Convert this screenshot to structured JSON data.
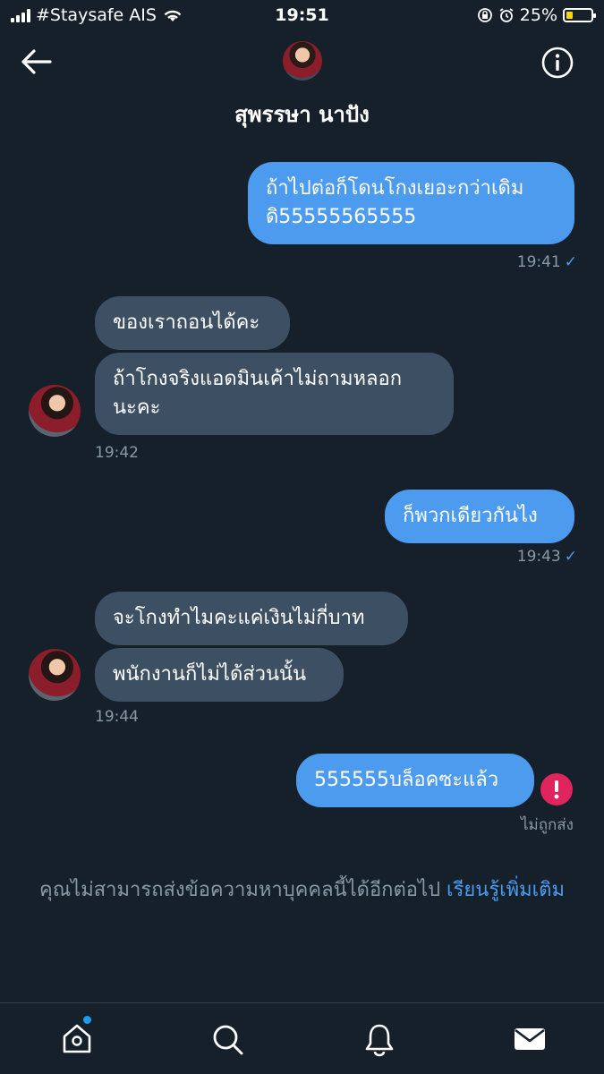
{
  "status": {
    "carrier": "#Staysafe AIS",
    "time": "19:51",
    "battery": "25%",
    "battery_level": 0.25
  },
  "header": {
    "title": "สุพรรษา นาปัง",
    "avatar_icon": "profile-avatar",
    "back_icon": "arrow-left-icon",
    "info_icon": "info-icon"
  },
  "messages": [
    {
      "direction": "sent",
      "lines": [
        "ถ้าไปต่อก็โดนโกงเยอะกว่าเดิม",
        "ดิ55555565555"
      ],
      "time": "19:41",
      "status": "✓"
    },
    {
      "direction": "received",
      "lines": [
        "ของเราถอนได้คะ"
      ]
    },
    {
      "direction": "received",
      "lines": [
        "ถ้าโกงจริงแอดมินเค้าไม่ถามหลอก",
        "นะคะ"
      ],
      "time": "19:42"
    },
    {
      "direction": "sent",
      "lines": [
        "ก็พวกเดียวกันไง"
      ],
      "time": "19:43",
      "status": "✓"
    },
    {
      "direction": "received",
      "lines": [
        "จะโกงทำไมคะแค่เงินไม่กี่บาท"
      ]
    },
    {
      "direction": "received",
      "lines": [
        "พนักงานก็ไม่ได้ส่วนนั้น"
      ],
      "time": "19:44"
    },
    {
      "direction": "sent",
      "lines": [
        "555555บล็อคซะแล้ว"
      ],
      "status_text": "ไม่ถูกส่ง"
    }
  ],
  "notice": {
    "text": "คุณไม่สามารถส่งข้อความหาบุคคลนี้ได้อีกต่อไป",
    "link": "เรียนรู้เพิ่มเติม"
  },
  "colors": {
    "background": "#15202b",
    "sent_bubble": "#4c9bef",
    "received_bubble": "#3d4f63",
    "error": "#e0245e",
    "muted": "#8899a6"
  },
  "bottom_nav": [
    "home-icon",
    "search-icon",
    "notifications-bell-icon",
    "messages-mail-icon"
  ]
}
